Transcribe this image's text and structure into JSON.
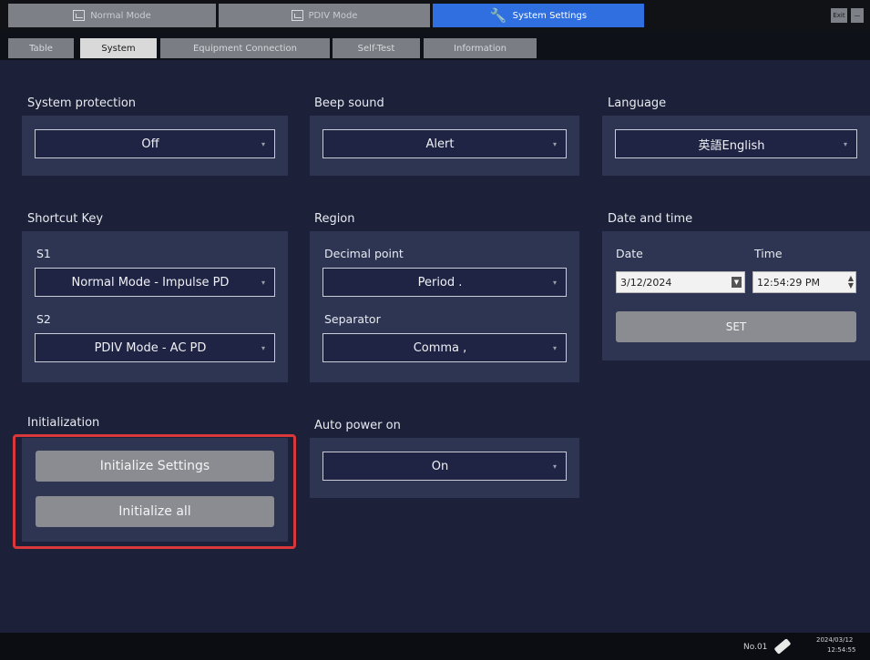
{
  "mode_tabs": [
    {
      "label": "Normal Mode",
      "icon": "monitor-icon",
      "active": false
    },
    {
      "label": "PDIV Mode",
      "icon": "chart-icon",
      "active": false
    },
    {
      "label": "System Settings",
      "icon": "wrench-icon",
      "active": true
    }
  ],
  "window_buttons": {
    "min": "Exit",
    "close": "—"
  },
  "sub_tabs": [
    {
      "label": "Table",
      "active": false
    },
    {
      "label": "System",
      "active": true
    },
    {
      "label": "Equipment Connection",
      "active": false
    },
    {
      "label": "Self-Test",
      "active": false
    },
    {
      "label": "Information",
      "active": false
    }
  ],
  "system_protection": {
    "title": "System protection",
    "value": "Off"
  },
  "beep_sound": {
    "title": "Beep sound",
    "value": "Alert"
  },
  "language": {
    "title": "Language",
    "value": "英語English"
  },
  "shortcut_key": {
    "title": "Shortcut Key",
    "s1_label": "S1",
    "s1_value": "Normal Mode - Impulse PD",
    "s2_label": "S2",
    "s2_value": "PDIV Mode - AC PD"
  },
  "region": {
    "title": "Region",
    "decimal_label": "Decimal point",
    "decimal_value": "Period .",
    "separator_label": "Separator",
    "separator_value": "Comma ,"
  },
  "date_time": {
    "title": "Date and time",
    "date_label": "Date",
    "date_value": "3/12/2024",
    "time_label": "Time",
    "time_value": "12:54:29 PM",
    "set_label": "SET"
  },
  "initialization": {
    "title": "Initialization",
    "init_settings_label": "Initialize Settings",
    "init_all_label": "Initialize all"
  },
  "auto_power": {
    "title": "Auto power on",
    "value": "On"
  },
  "status": {
    "device": "No.01",
    "date": "2024/03/12",
    "time": "12:54:55"
  },
  "colors": {
    "accent": "#2f6fe0",
    "highlight": "#d9383a",
    "background": "#1c2038",
    "panel": "#2d3553"
  }
}
